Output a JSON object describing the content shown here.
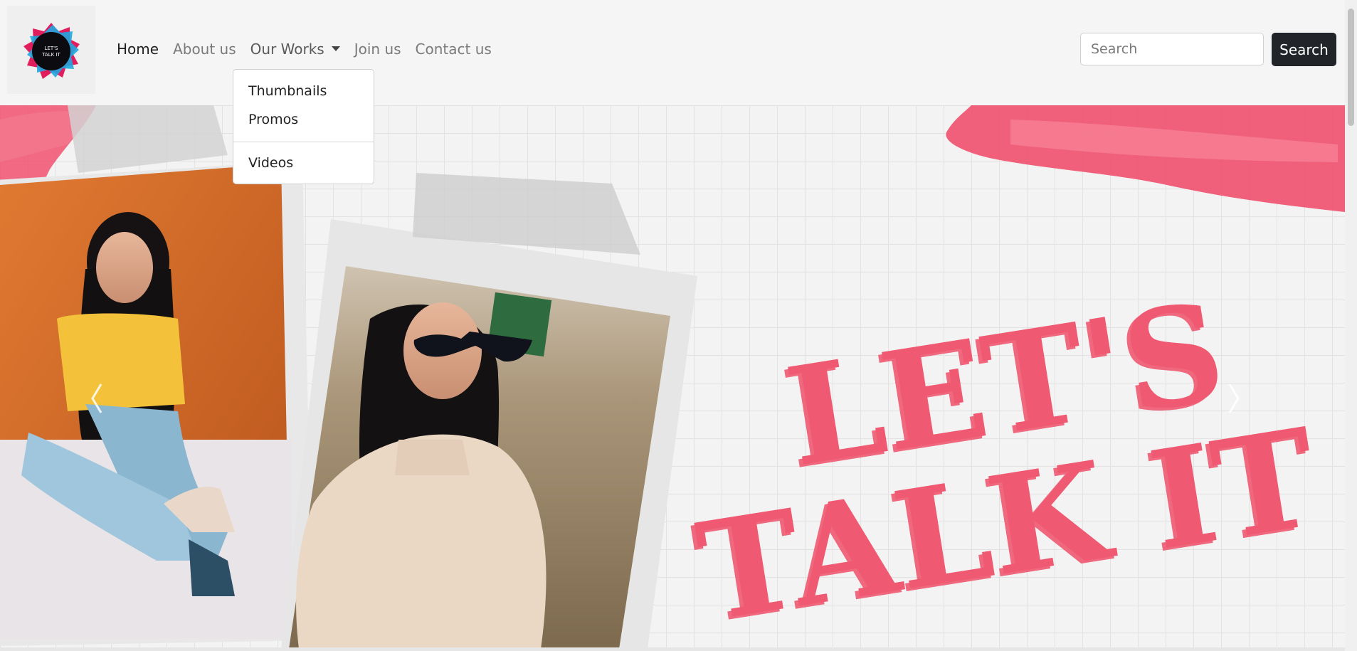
{
  "brand": {
    "logo_icon": "lets-talk-it-logo",
    "logo_text_line1": "LET'S",
    "logo_text_line2": "TALK IT"
  },
  "nav": {
    "items": [
      {
        "label": "Home",
        "active": true
      },
      {
        "label": "About us",
        "active": false
      },
      {
        "label": "Our Works",
        "active": false,
        "dropdown": true
      },
      {
        "label": "Join us",
        "active": false
      },
      {
        "label": "Contact us",
        "active": false
      }
    ]
  },
  "dropdown": {
    "items": [
      "Thumbnails",
      "Promos",
      "Videos"
    ]
  },
  "search": {
    "placeholder": "Search",
    "button_label": "Search"
  },
  "hero": {
    "title_line1": "LET'S",
    "title_line2": "TALK IT",
    "prev_icon": "chevron-left-icon",
    "next_icon": "chevron-right-icon"
  },
  "colors": {
    "accent_pink": "#ef5a72",
    "brush_pink": "#f0506e",
    "button_dark": "#212529"
  }
}
